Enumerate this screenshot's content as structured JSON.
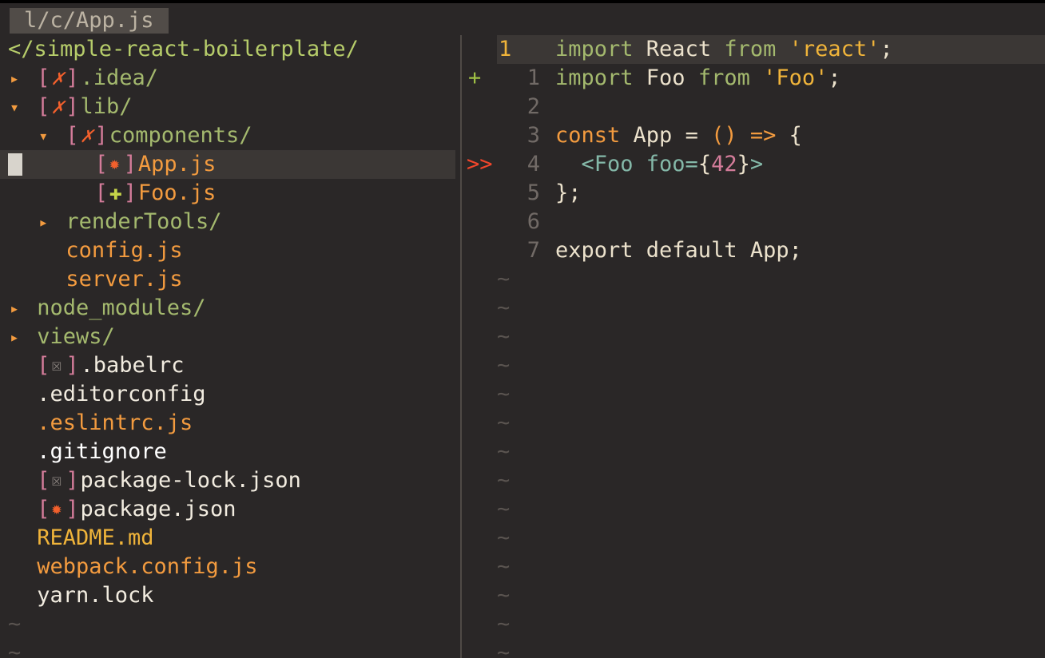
{
  "tabline": {
    "active_tab": "l/c/App.js"
  },
  "tree": {
    "root": "</simple-react-boilerplate/",
    "items": [
      {
        "indent": 0,
        "arrow": "▸",
        "git": "✗",
        "git_kind": "x",
        "name": ".idea/",
        "color": "green"
      },
      {
        "indent": 0,
        "arrow": "▾",
        "git": "✗",
        "git_kind": "x",
        "name": "lib/",
        "color": "green"
      },
      {
        "indent": 1,
        "arrow": "▾",
        "git": "✗",
        "git_kind": "x",
        "name": "components/",
        "color": "green"
      },
      {
        "indent": 2,
        "arrow": "",
        "git": "✹",
        "git_kind": "star",
        "name": "App.js",
        "color": "orange",
        "cursor": true
      },
      {
        "indent": 2,
        "arrow": "",
        "git": "✚",
        "git_kind": "plus",
        "name": "Foo.js",
        "color": "orange"
      },
      {
        "indent": 1,
        "arrow": "▸",
        "git": "",
        "git_kind": "",
        "name": "renderTools/",
        "color": "green"
      },
      {
        "indent": 1,
        "arrow": "",
        "git": "",
        "git_kind": "",
        "name": "config.js",
        "color": "orange"
      },
      {
        "indent": 1,
        "arrow": "",
        "git": "",
        "git_kind": "",
        "name": "server.js",
        "color": "orange"
      },
      {
        "indent": 0,
        "arrow": "▸",
        "git": "",
        "git_kind": "",
        "name": "node_modules/",
        "color": "green"
      },
      {
        "indent": 0,
        "arrow": "▸",
        "git": "",
        "git_kind": "",
        "name": "views/",
        "color": "green"
      },
      {
        "indent": 0,
        "arrow": "",
        "git": "☒",
        "git_kind": "ign",
        "name": ".babelrc",
        "color": "white"
      },
      {
        "indent": 0,
        "arrow": "",
        "git": "",
        "git_kind": "",
        "name": ".editorconfig",
        "color": "white"
      },
      {
        "indent": 0,
        "arrow": "",
        "git": "",
        "git_kind": "",
        "name": ".eslintrc.js",
        "color": "orange"
      },
      {
        "indent": 0,
        "arrow": "",
        "git": "",
        "git_kind": "",
        "name": ".gitignore",
        "color": "bright"
      },
      {
        "indent": 0,
        "arrow": "",
        "git": "☒",
        "git_kind": "ign",
        "name": "package-lock.json",
        "color": "white"
      },
      {
        "indent": 0,
        "arrow": "",
        "git": "✹",
        "git_kind": "star",
        "name": "package.json",
        "color": "white"
      },
      {
        "indent": 0,
        "arrow": "",
        "git": "",
        "git_kind": "",
        "name": "README.md",
        "color": "yellow"
      },
      {
        "indent": 0,
        "arrow": "",
        "git": "",
        "git_kind": "",
        "name": "webpack.config.js",
        "color": "orange"
      },
      {
        "indent": 0,
        "arrow": "",
        "git": "",
        "git_kind": "",
        "name": "yarn.lock",
        "color": "white"
      }
    ],
    "tilde": "~"
  },
  "editor": {
    "lines": [
      {
        "sign": "",
        "num": "1",
        "current": true,
        "tokens": [
          [
            "kw",
            "import "
          ],
          [
            "id",
            "React "
          ],
          [
            "kw",
            "from "
          ],
          [
            "str",
            "'react'"
          ],
          [
            "punc",
            ";"
          ]
        ]
      },
      {
        "sign": "+",
        "sign_kind": "add",
        "num": "1",
        "tokens": [
          [
            "kw",
            "import "
          ],
          [
            "id",
            "Foo "
          ],
          [
            "kw",
            "from "
          ],
          [
            "str",
            "'Foo'"
          ],
          [
            "punc",
            ";"
          ]
        ]
      },
      {
        "sign": "",
        "num": "2",
        "tokens": []
      },
      {
        "sign": "",
        "num": "3",
        "tokens": [
          [
            "const",
            "const "
          ],
          [
            "id",
            "App "
          ],
          [
            "punc",
            "= "
          ],
          [
            "op",
            "() => "
          ],
          [
            "punc",
            "{"
          ]
        ]
      },
      {
        "sign": ">>",
        "sign_kind": "err",
        "num": "4",
        "tokens": [
          [
            "punc",
            "  "
          ],
          [
            "tag",
            "<Foo foo="
          ],
          [
            "punc",
            "{"
          ],
          [
            "num",
            "42"
          ],
          [
            "punc",
            "}"
          ],
          [
            "tag",
            ">"
          ]
        ]
      },
      {
        "sign": "",
        "num": "5",
        "tokens": [
          [
            "punc",
            "};"
          ]
        ]
      },
      {
        "sign": "",
        "num": "6",
        "tokens": []
      },
      {
        "sign": "",
        "num": "7",
        "tokens": [
          [
            "id",
            "export default App;"
          ]
        ]
      }
    ],
    "tilde": "~"
  },
  "colors": {
    "background": "#2a2727",
    "cursorline": "#3b3735",
    "keyword": "#a4b96e",
    "string": "#f0b43a",
    "orange": "#f39b3f",
    "error_sign": "#f0462b",
    "add_sign": "#9fbf45"
  }
}
